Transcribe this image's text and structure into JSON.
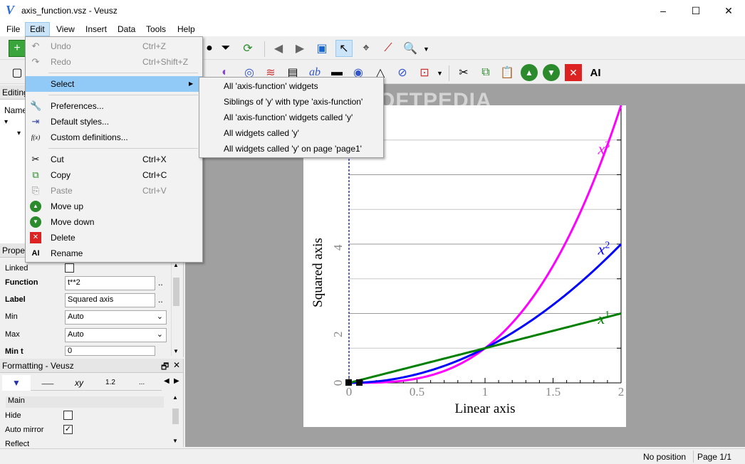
{
  "window": {
    "title": "axis_function.vsz - Veusz",
    "logo": "V",
    "minimize": "–",
    "maximize": "☐",
    "close": "✕"
  },
  "menubar": [
    "File",
    "Edit",
    "View",
    "Insert",
    "Data",
    "Tools",
    "Help"
  ],
  "edit_menu": {
    "undo": {
      "label": "Undo",
      "shortcut": "Ctrl+Z"
    },
    "redo": {
      "label": "Redo",
      "shortcut": "Ctrl+Shift+Z"
    },
    "select": {
      "label": "Select",
      "arrow": "▶"
    },
    "preferences": {
      "label": "Preferences..."
    },
    "default_styles": {
      "label": "Default styles..."
    },
    "custom_definitions": {
      "label": "Custom definitions...",
      "icon_text": "f(x)"
    },
    "cut": {
      "label": "Cut",
      "shortcut": "Ctrl+X"
    },
    "copy": {
      "label": "Copy",
      "shortcut": "Ctrl+C"
    },
    "paste": {
      "label": "Paste",
      "shortcut": "Ctrl+V"
    },
    "move_up": {
      "label": "Move up"
    },
    "move_down": {
      "label": "Move down"
    },
    "delete": {
      "label": "Delete"
    },
    "rename": {
      "label": "Rename",
      "icon_text": "AI"
    }
  },
  "select_submenu": [
    "All 'axis-function' widgets",
    "Siblings of 'y' with type 'axis-function'",
    "All 'axis-function' widgets called 'y'",
    "All widgets called 'y'",
    "All widgets called 'y' on page 'page1'"
  ],
  "panels": {
    "editing_header": "Editing",
    "name_header": "Name",
    "properties_header": "Proper",
    "formatting_header": "Formatting - Veusz",
    "formatting_tabs": [
      "▼",
      "___",
      "xy",
      "1.2",
      "..."
    ],
    "formatting_section": "Main"
  },
  "properties": {
    "linked": {
      "label": "Linked",
      "checked": false
    },
    "function": {
      "label": "Function",
      "value": "t**2",
      "more": ".."
    },
    "label": {
      "label": "Label",
      "value": "Squared axis",
      "more": ".."
    },
    "min": {
      "label": "Min",
      "value": "Auto"
    },
    "max": {
      "label": "Max",
      "value": "Auto"
    },
    "min_t": {
      "label": "Min t",
      "value": "0"
    }
  },
  "formatting": {
    "hide": {
      "label": "Hide",
      "checked": false
    },
    "auto_mirror": {
      "label": "Auto mirror",
      "checked": true
    },
    "reflect": {
      "label": "Reflect",
      "checked": false
    }
  },
  "status": {
    "position": "No position",
    "page": "Page 1/1"
  },
  "watermark": "SOFTPEDIA",
  "chart_data": {
    "type": "line",
    "xlabel": "Linear axis",
    "ylabel": "Squared axis",
    "xlim": [
      0,
      2
    ],
    "ylim": [
      0,
      8
    ],
    "x_ticks": [
      "0",
      "0.5",
      "1",
      "1.5",
      "2"
    ],
    "y_ticks": [
      "0",
      "2",
      "4"
    ],
    "series": [
      {
        "name": "x³",
        "base": "x",
        "exp": "3",
        "power": 3,
        "color": "#ff00ff"
      },
      {
        "name": "x²",
        "base": "x",
        "exp": "2",
        "power": 2,
        "color": "#0000ff"
      },
      {
        "name": "x¹",
        "base": "x",
        "exp": "1",
        "power": 1,
        "color": "#008000"
      }
    ]
  }
}
